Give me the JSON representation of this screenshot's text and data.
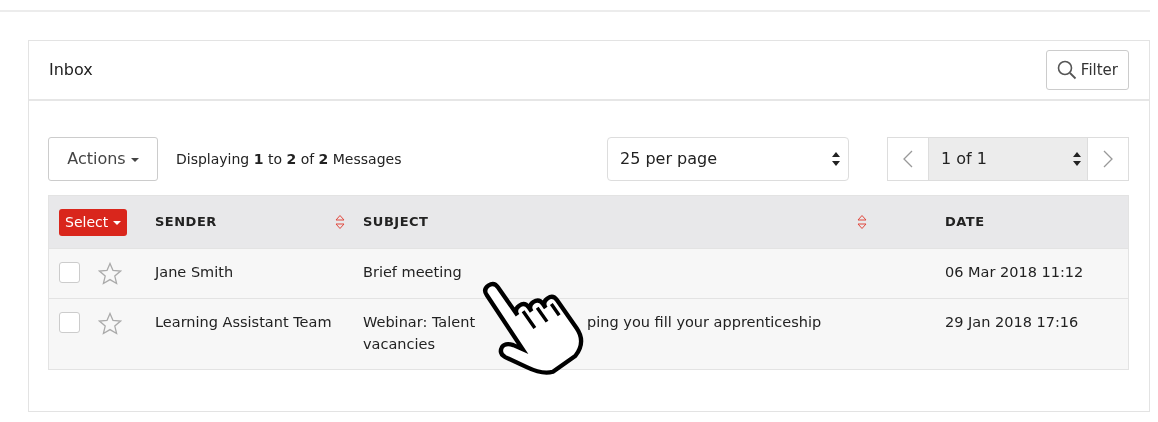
{
  "panel": {
    "title": "Inbox",
    "filter_button": "Filter"
  },
  "toolbar": {
    "actions_button": "Actions",
    "summary": "Displaying **1** to **2** of **2** Messages",
    "per_page": "25 per page",
    "page": "1 of 1"
  },
  "table": {
    "select_button": "Select",
    "columns": [
      {
        "label": "SENDER",
        "sortable": true
      },
      {
        "label": "SUBJECT",
        "sortable": true
      },
      {
        "label": "DATE",
        "sortable": false
      }
    ],
    "rows": [
      {
        "checked": false,
        "starred": false,
        "sender": "Jane Smith",
        "subject_lines": [
          [
            "Brief meeting"
          ]
        ],
        "date": "06 Mar 2018 11:12"
      },
      {
        "checked": false,
        "starred": false,
        "sender": "Learning Assistant Team",
        "subject_lines": [
          [
            "Webinar: Talent",
            "ping you fill your apprenticeship"
          ],
          [
            "vacancies"
          ]
        ],
        "date": "29 Jan 2018 17:16"
      }
    ]
  },
  "cursor": {
    "kind": "hand"
  }
}
